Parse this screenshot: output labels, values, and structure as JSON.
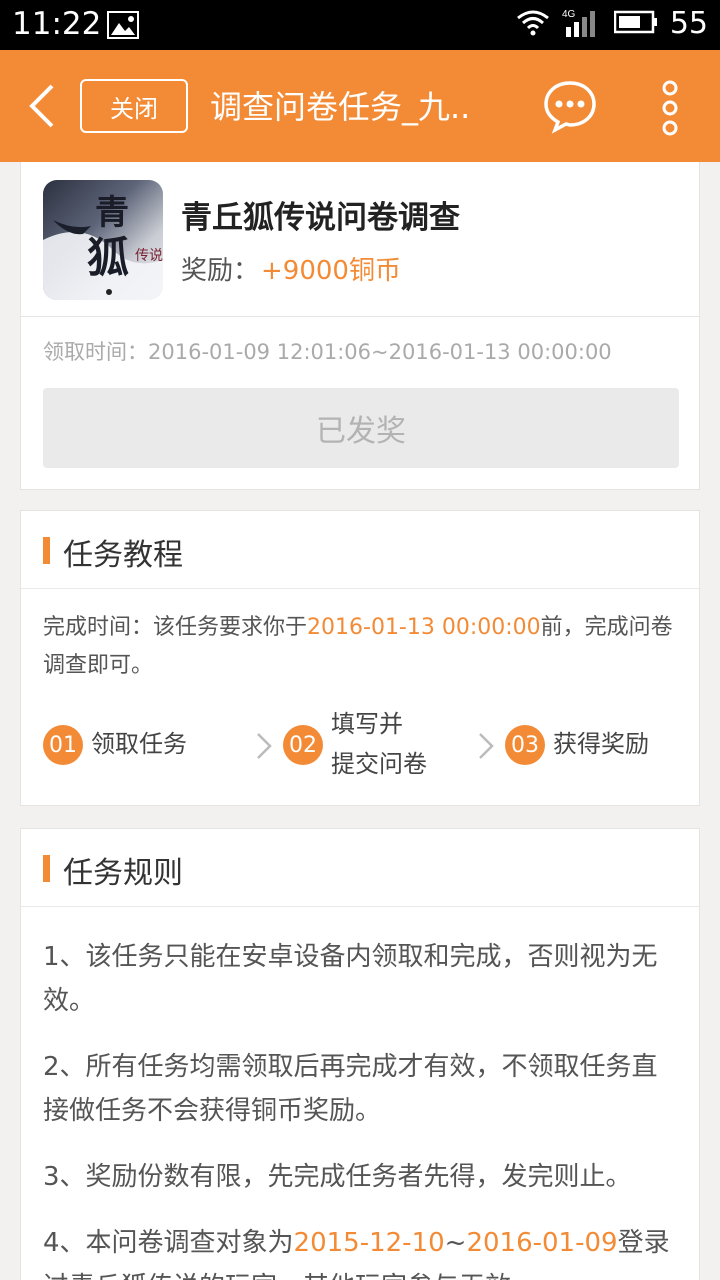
{
  "status_bar": {
    "time": "11:22",
    "network": "4G",
    "battery": "55",
    "icons": [
      "image-icon",
      "wifi-icon",
      "signal-icon",
      "battery-icon"
    ]
  },
  "app_bar": {
    "close_label": "关闭",
    "title": "调查问卷任务_九..",
    "icons": [
      "back-icon",
      "chat-icon",
      "more-icon"
    ],
    "accent_color": "#f38b36"
  },
  "task": {
    "game_name": "青丘狐传说问卷调查",
    "reward_label": "奖励：",
    "reward_value": "+9000铜币",
    "claim_time": "领取时间：2016-01-09 12:01:06~2016-01-13 00:00:00",
    "status_button": "已发奖"
  },
  "tutorial": {
    "title": "任务教程",
    "complete_prefix": "完成时间：该任务要求你于",
    "complete_date": "2016-01-13 00:00:00",
    "complete_suffix": "前，完成问卷调查即可。",
    "steps": [
      {
        "num": "01",
        "label": "领取任务"
      },
      {
        "num": "02",
        "label_line1": "填写并",
        "label_line2": "提交问卷"
      },
      {
        "num": "03",
        "label": "获得奖励"
      }
    ]
  },
  "rules": {
    "title": "任务规则",
    "items": [
      "1、该任务只能在安卓设备内领取和完成，否则视为无效。",
      "2、所有任务均需领取后再完成才有效，不领取任务直接做任务不会获得铜币奖励。",
      "3、奖励份数有限，先完成任务者先得，发完则止。"
    ],
    "item4_prefix": "4、本问卷调查对象为",
    "item4_date1": "2015-12-10",
    "item4_sep": "~",
    "item4_date2": "2016-01-09",
    "item4_suffix": "登录过青丘狐传说的玩家，其他玩家参与无效。"
  }
}
